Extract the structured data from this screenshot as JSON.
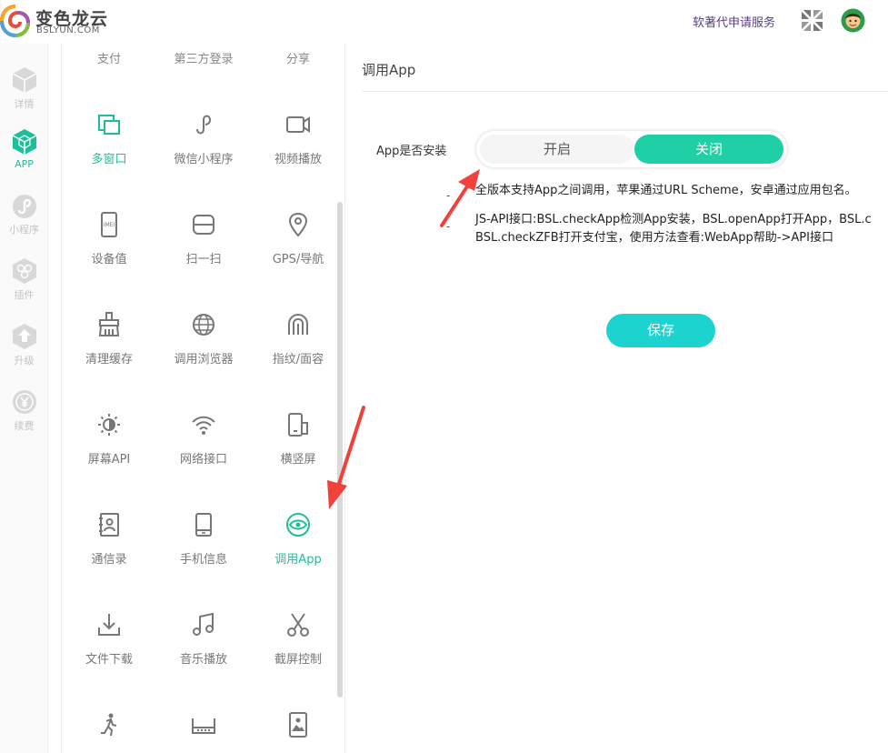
{
  "header": {
    "logo_cn": "变色龙云",
    "logo_en": "BSLYUN.COM",
    "service_link": "软著代申请服务"
  },
  "leftnav": {
    "items": [
      {
        "label": "详情",
        "icon": "hexagon-cube-icon"
      },
      {
        "label": "APP",
        "icon": "app-cube-icon",
        "active": true
      },
      {
        "label": "小程序",
        "icon": "mini-program-icon"
      },
      {
        "label": "插件",
        "icon": "plugin-icon"
      },
      {
        "label": "升级",
        "icon": "upgrade-icon"
      },
      {
        "label": "续费",
        "icon": "renew-yen-icon"
      }
    ]
  },
  "features": {
    "top_labels": [
      "支付",
      "第三方登录",
      "分享"
    ],
    "items": [
      {
        "label": "多窗口",
        "icon": "multi-window-icon",
        "active": true
      },
      {
        "label": "微信小程序",
        "icon": "wechat-mini-icon"
      },
      {
        "label": "视频播放",
        "icon": "video-icon"
      },
      {
        "label": "设备值",
        "icon": "imei-icon"
      },
      {
        "label": "扫一扫",
        "icon": "scan-icon"
      },
      {
        "label": "GPS/导航",
        "icon": "location-pin-icon"
      },
      {
        "label": "清理缓存",
        "icon": "broom-icon"
      },
      {
        "label": "调用浏览器",
        "icon": "globe-icon"
      },
      {
        "label": "指纹/面容",
        "icon": "fingerprint-icon"
      },
      {
        "label": "屏幕API",
        "icon": "brightness-icon"
      },
      {
        "label": "网络接口",
        "icon": "wifi-icon"
      },
      {
        "label": "横竖屏",
        "icon": "rotate-screen-icon"
      },
      {
        "label": "通信录",
        "icon": "contacts-icon"
      },
      {
        "label": "手机信息",
        "icon": "phone-icon"
      },
      {
        "label": "调用App",
        "icon": "eye-icon",
        "active": true
      },
      {
        "label": "文件下载",
        "icon": "download-icon"
      },
      {
        "label": "音乐播放",
        "icon": "music-icon"
      },
      {
        "label": "截屏控制",
        "icon": "scissors-icon"
      },
      {
        "label": "",
        "icon": "running-icon"
      },
      {
        "label": "",
        "icon": "keyboard-icon"
      },
      {
        "label": "",
        "icon": "image-icon"
      }
    ]
  },
  "content": {
    "title": "调用App",
    "field_label": "App是否安装",
    "toggle": {
      "on": "开启",
      "off": "关闭",
      "selected": "关闭"
    },
    "desc1": "全版本支持App之间调用，苹果通过URL Scheme，安卓通过应用包名。",
    "desc2a": "JS-API接口:BSL.checkApp检测App安装，BSL.openApp打开App，BSL.c",
    "desc2b": "BSL.checkZFB打开支付宝，使用方法查看:WebApp帮助->API接口",
    "dash1": "-",
    "dash2": "-",
    "save": "保存"
  },
  "colors": {
    "accent": "#1fcfa6",
    "save": "#1dd3cf",
    "arrow": "#f0413b",
    "service": "#5a3b8c"
  }
}
